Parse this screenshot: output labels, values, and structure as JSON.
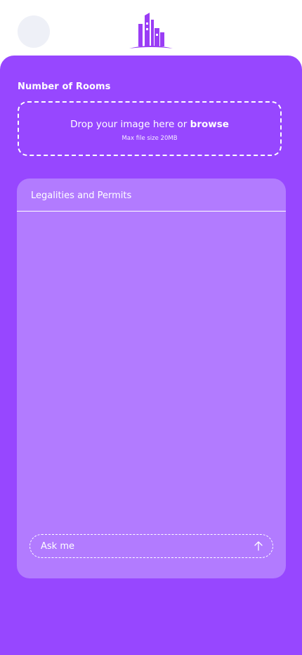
{
  "header": {
    "avatar_icon": "avatar-placeholder",
    "logo_icon": "city-buildings-logo",
    "brand_color": "#9747ff"
  },
  "upload": {
    "section_title": "Number of Rooms",
    "drop_text": "Drop your image here or",
    "browse_label": "browse",
    "max_size_text": "Max file size 20MB"
  },
  "chat": {
    "title": "Legalities and Permits",
    "input_placeholder": "Ask me",
    "send_icon": "arrow-up-icon"
  },
  "colors": {
    "panel": "#9747ff",
    "card": "#b27bff",
    "avatar_bg": "#eef0f7"
  }
}
